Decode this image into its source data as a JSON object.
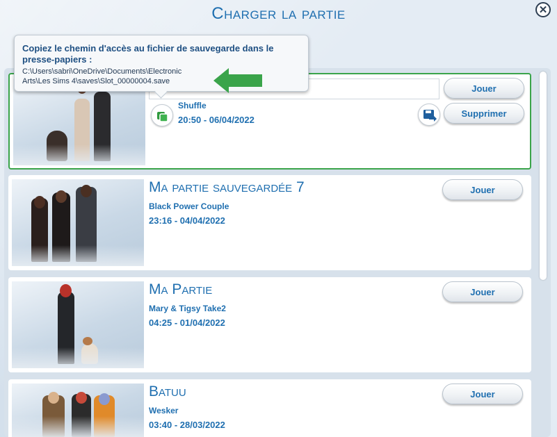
{
  "dialog": {
    "title": "Charger la partie"
  },
  "tooltip": {
    "heading": "Copiez le chemin d'accès au fichier de sauvegarde dans le presse-papiers :",
    "path_line1": "C:\\Users\\sabri\\OneDrive\\Documents\\Electronic",
    "path_line2": "Arts\\Les  Sims  4\\saves\\Slot_00000004.save"
  },
  "saves": [
    {
      "title": "",
      "household": "Shuffle",
      "datetime": "20:50  -  06/04/2022",
      "play_label": "Jouer",
      "delete_label": "Supprimer"
    },
    {
      "title": "Ma partie sauvegardée 7",
      "household": "Black Power Couple",
      "datetime": "23:16  -  04/04/2022",
      "play_label": "Jouer"
    },
    {
      "title": "Ma Partie",
      "household": "Mary & Tigsy Take2",
      "datetime": "04:25  -  01/04/2022",
      "play_label": "Jouer"
    },
    {
      "title": "Batuu",
      "household": "Wesker",
      "datetime": "03:40  -  28/03/2022",
      "play_label": "Jouer"
    }
  ],
  "colors": {
    "accent": "#1f6fb0",
    "selected_border": "#3aa44a",
    "arrow": "#3aa44a"
  }
}
